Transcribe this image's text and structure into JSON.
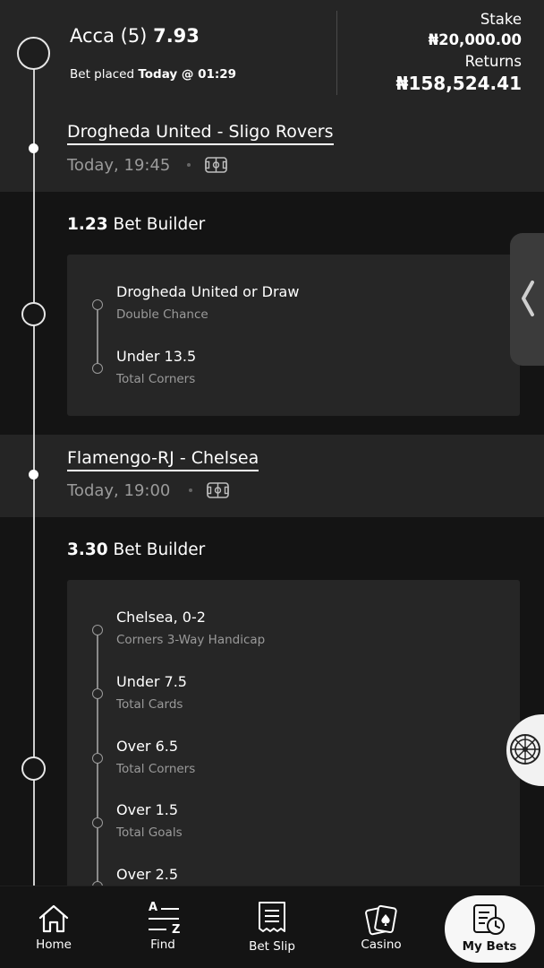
{
  "bet": {
    "title": "Acca (5)",
    "odds": "7.93",
    "placed_label": "Bet placed",
    "placed_when": "Today @ 01:29",
    "stake_label": "Stake",
    "stake_value": "₦20,000.00",
    "returns_label": "Returns",
    "returns_value": "₦158,524.41"
  },
  "matches": [
    {
      "name": "Drogheda United - Sligo Rovers",
      "time": "Today, 19:45",
      "builder_odds": "1.23",
      "builder_label": "Bet Builder",
      "legs": [
        {
          "selection": "Drogheda United or Draw",
          "market": "Double Chance"
        },
        {
          "selection": "Under 13.5",
          "market": "Total Corners"
        }
      ]
    },
    {
      "name": "Flamengo-RJ - Chelsea",
      "time": "Today, 19:00",
      "builder_odds": "3.30",
      "builder_label": "Bet Builder",
      "legs": [
        {
          "selection": "Chelsea, 0-2",
          "market": "Corners 3-Way Handicap"
        },
        {
          "selection": "Under 7.5",
          "market": "Total Cards"
        },
        {
          "selection": "Over 6.5",
          "market": "Total Corners"
        },
        {
          "selection": "Over 1.5",
          "market": "Total Goals"
        },
        {
          "selection": "Over 2.5",
          "market": ""
        }
      ]
    }
  ],
  "nav": {
    "home": "Home",
    "find": "Find",
    "betslip": "Bet Slip",
    "casino": "Casino",
    "mybets": "My Bets",
    "find_icon_top": "A",
    "find_icon_bottom": "Z"
  },
  "icons": {
    "side_tab": "chevron-left-icon",
    "wheel": "roulette-wheel-icon",
    "pitch": "football-pitch-icon"
  }
}
